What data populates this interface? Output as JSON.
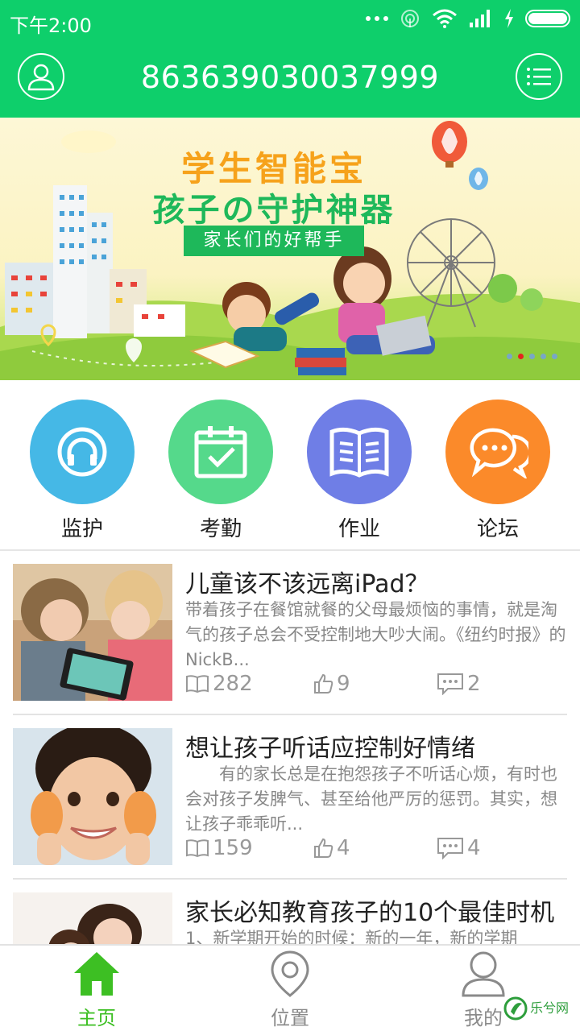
{
  "status_bar": {
    "time": "下午2:00"
  },
  "header": {
    "title": "863639030037999"
  },
  "banner": {
    "title": "学生智能宝",
    "subtitle": "孩子の守护神器",
    "tag": "家长们的好帮手",
    "active_slide": 2
  },
  "features": [
    {
      "label": "监护",
      "color": "#45b8e6",
      "icon": "headphones-icon"
    },
    {
      "label": "考勤",
      "color": "#55d98b",
      "icon": "calendar-check-icon"
    },
    {
      "label": "作业",
      "color": "#6f7ee6",
      "icon": "book-icon"
    },
    {
      "label": "论坛",
      "color": "#fb8a2a",
      "icon": "chat-bubbles-icon"
    }
  ],
  "news": [
    {
      "title": "儿童该不该远离iPad？",
      "summary": "带着孩子在餐馆就餐的父母最烦恼的事情，就是淘气的孩子总会不受控制地大吵大闹。《纽约时报》的NickB...",
      "reads": "282",
      "likes": "9",
      "comments": "2"
    },
    {
      "title": "想让孩子听话应控制好情绪",
      "summary": "　　有的家长总是在抱怨孩子不听话心烦，有时也会对孩子发脾气、甚至给他严厉的惩罚。其实，想让孩子乖乖听...",
      "reads": "159",
      "likes": "4",
      "comments": "4"
    },
    {
      "title": "家长必知教育孩子的10个最佳时机",
      "summary": "1、新学期开始的时候：新的一年，新的学期",
      "reads": "",
      "likes": "",
      "comments": ""
    }
  ],
  "bottom_nav": [
    {
      "label": "主页",
      "icon": "home-icon",
      "active": true
    },
    {
      "label": "位置",
      "icon": "location-pin-icon",
      "active": false
    },
    {
      "label": "我的",
      "icon": "user-icon",
      "active": false
    }
  ],
  "watermark": {
    "text": "乐兮网"
  },
  "colors": {
    "brand": "#0ecf6b",
    "active_nav": "#3dbf23",
    "inactive_nav": "#8a8a8a"
  }
}
